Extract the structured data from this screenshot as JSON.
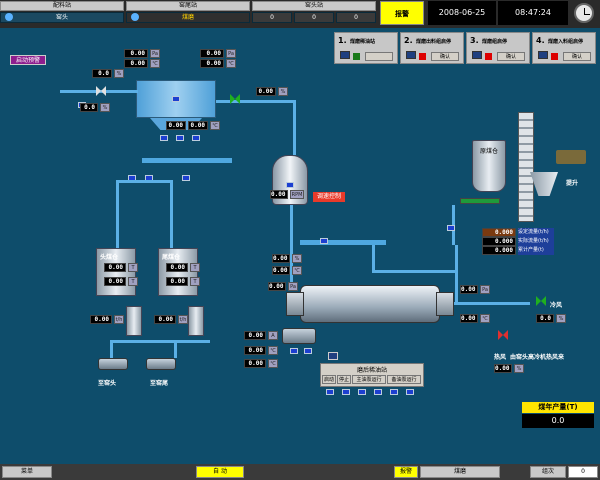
{
  "header": {
    "sites": [
      {
        "name": "配料站",
        "sub": "窑头"
      },
      {
        "name": "窑尾站",
        "sub": "煤磨"
      },
      {
        "name": "窑头站",
        "sub": ""
      }
    ],
    "values": [
      "0",
      "0",
      "0"
    ],
    "alarm_label": "报警",
    "date": "2008-06-25",
    "time": "08:47:24"
  },
  "alarm_pre_label": "启动预警",
  "control_panels": [
    {
      "num": "1.",
      "title": "煤磨稀油站",
      "btn": ""
    },
    {
      "num": "2.",
      "title": "煤磨出料组启停",
      "btn": "确认"
    },
    {
      "num": "3.",
      "title": "煤磨组启停",
      "btn": "确认"
    },
    {
      "num": "4.",
      "title": "煤磨入料组启停",
      "btn": "确认"
    }
  ],
  "labels": {
    "raw_coal_bin": "原煤仓",
    "hoist": "提升",
    "head_coal_bin": "头煤仓",
    "tail_coal_bin": "尾煤仓",
    "to_kiln_head": "至窑头",
    "to_kiln_tail": "至窑尾",
    "cold_air": "冷风",
    "hot_air": "热风",
    "from_kiln_head": "由窑头高冷机热风来",
    "speed_control": "调速控制",
    "grinder_oil": "磨后稀油站",
    "annual_output_title": "煤年产量(T)",
    "annual_output_value": "0.0"
  },
  "oil_station_buttons": [
    "启动",
    "停止",
    "主油泵运行",
    "备油泵运行"
  ],
  "flow_table": [
    {
      "value": "0.000",
      "label": "设定流量(t/h)"
    },
    {
      "value": "0.000",
      "label": "实际流量(t/h)"
    },
    {
      "value": "0.000",
      "label": "累计产量(t)"
    }
  ],
  "readings": {
    "v_top1": "0.00",
    "v_top2": "0.00",
    "v_top3": "0.00",
    "v_top4": "0.00",
    "v_l1": "0.0",
    "v_l2": "0.0",
    "v_valve": "0.00",
    "v_bag1": "0.00",
    "v_bag2": "0.00",
    "v_sep": "0.00",
    "v_mid1": "0.00",
    "v_mid2": "0.00",
    "v_head1": "0.00",
    "v_head2": "0.00",
    "v_tail1": "0.00",
    "v_tail2": "0.00",
    "v_mill_l": "0.00",
    "v_mill_r": "0.00",
    "v_mill_b": "0.00",
    "v_hot": "0.00",
    "v_cold": "0.0",
    "v_h1": "0.00",
    "v_h2": "0.00",
    "v_hb1": "0.00",
    "v_hb2": "0.00",
    "v_motor1": "0.00",
    "v_motor2": "0.00",
    "v_motor3": "0.00",
    "v_sm1": "0.00",
    "v_sm2": "0.00"
  },
  "footer": {
    "menu": "菜单",
    "auto": "自 动",
    "alarm": "报警",
    "coal_mill": "煤磨",
    "group": "组次",
    "group_value": "0"
  },
  "colors": {
    "background": "#0e4d6b",
    "pipe": "#5bb0e6",
    "alarm_yellow": "#ffff00"
  }
}
